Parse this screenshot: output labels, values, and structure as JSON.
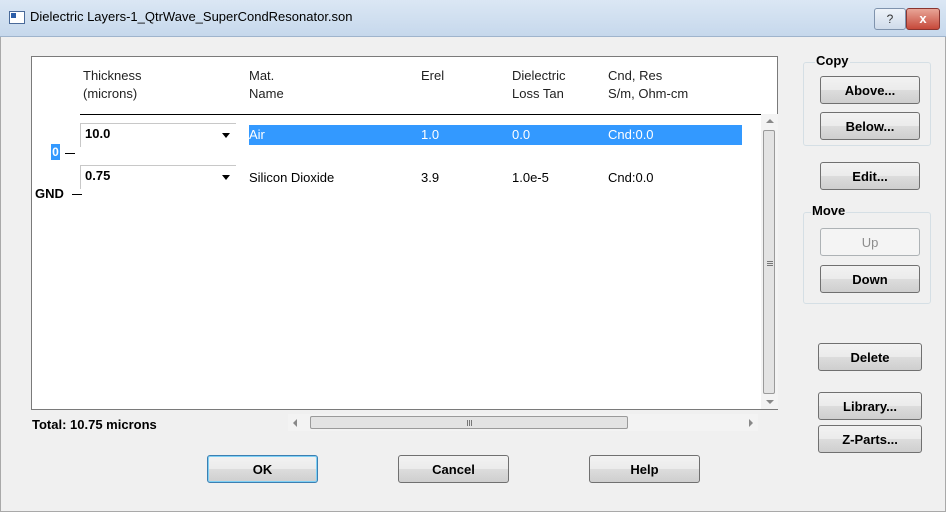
{
  "window": {
    "title": "Dielectric Layers-1_QtrWave_SuperCondResonator.son",
    "help_glyph": "?",
    "close_glyph": "x"
  },
  "columns": {
    "thickness": [
      "Thickness",
      "(microns)"
    ],
    "mat_name": [
      "Mat.",
      "Name"
    ],
    "erel": [
      "Erel"
    ],
    "loss_tan": [
      "Dielectric",
      "Loss Tan"
    ],
    "cnd": [
      "Cnd, Res",
      "S/m, Ohm-cm"
    ]
  },
  "layers": [
    {
      "thickness": "10.0",
      "name": "Air",
      "erel": "1.0",
      "loss_tan": "0.0",
      "cnd": "Cnd:0.0",
      "selected": true
    },
    {
      "thickness": "0.75",
      "name": "Silicon Dioxide",
      "erel": "3.9",
      "loss_tan": "1.0e-5",
      "cnd": "Cnd:0.0",
      "selected": false
    }
  ],
  "boundary_labels": {
    "interface": "0",
    "ground": "GND"
  },
  "total": "Total: 10.75 microns",
  "copy_group": {
    "label": "Copy",
    "above": "Above...",
    "below": "Below..."
  },
  "edit_button": "Edit...",
  "move_group": {
    "label": "Move",
    "up": "Up",
    "down": "Down"
  },
  "delete_button": "Delete",
  "library_button": "Library...",
  "zparts_button": "Z-Parts...",
  "ok_button": "OK",
  "cancel_button": "Cancel",
  "help_button": "Help",
  "colors": {
    "selection": "#3399ff",
    "dialog_bg": "#f0f0f0"
  }
}
